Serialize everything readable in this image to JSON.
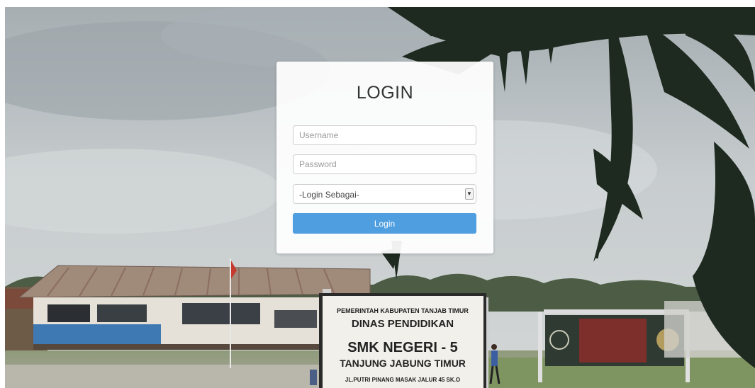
{
  "login": {
    "title": "LOGIN",
    "username_placeholder": "Username",
    "password_placeholder": "Password",
    "role_select_value": "-Login Sebagai-",
    "submit_label": "Login"
  },
  "background_sign": {
    "line1": "PEMERINTAH KABUPATEN TANJAB TIMUR",
    "line2": "DINAS PENDIDIKAN",
    "line3": "SMK NEGERI - 5",
    "line4": "TANJUNG JABUNG TIMUR",
    "line5": "JL.PUTRI PINANG MASAK JALUR 45 SK.O"
  },
  "colors": {
    "button": "#4e9ee0",
    "card": "#ffffff"
  },
  "icons": {
    "select_arrow": "chevron-down-icon"
  }
}
